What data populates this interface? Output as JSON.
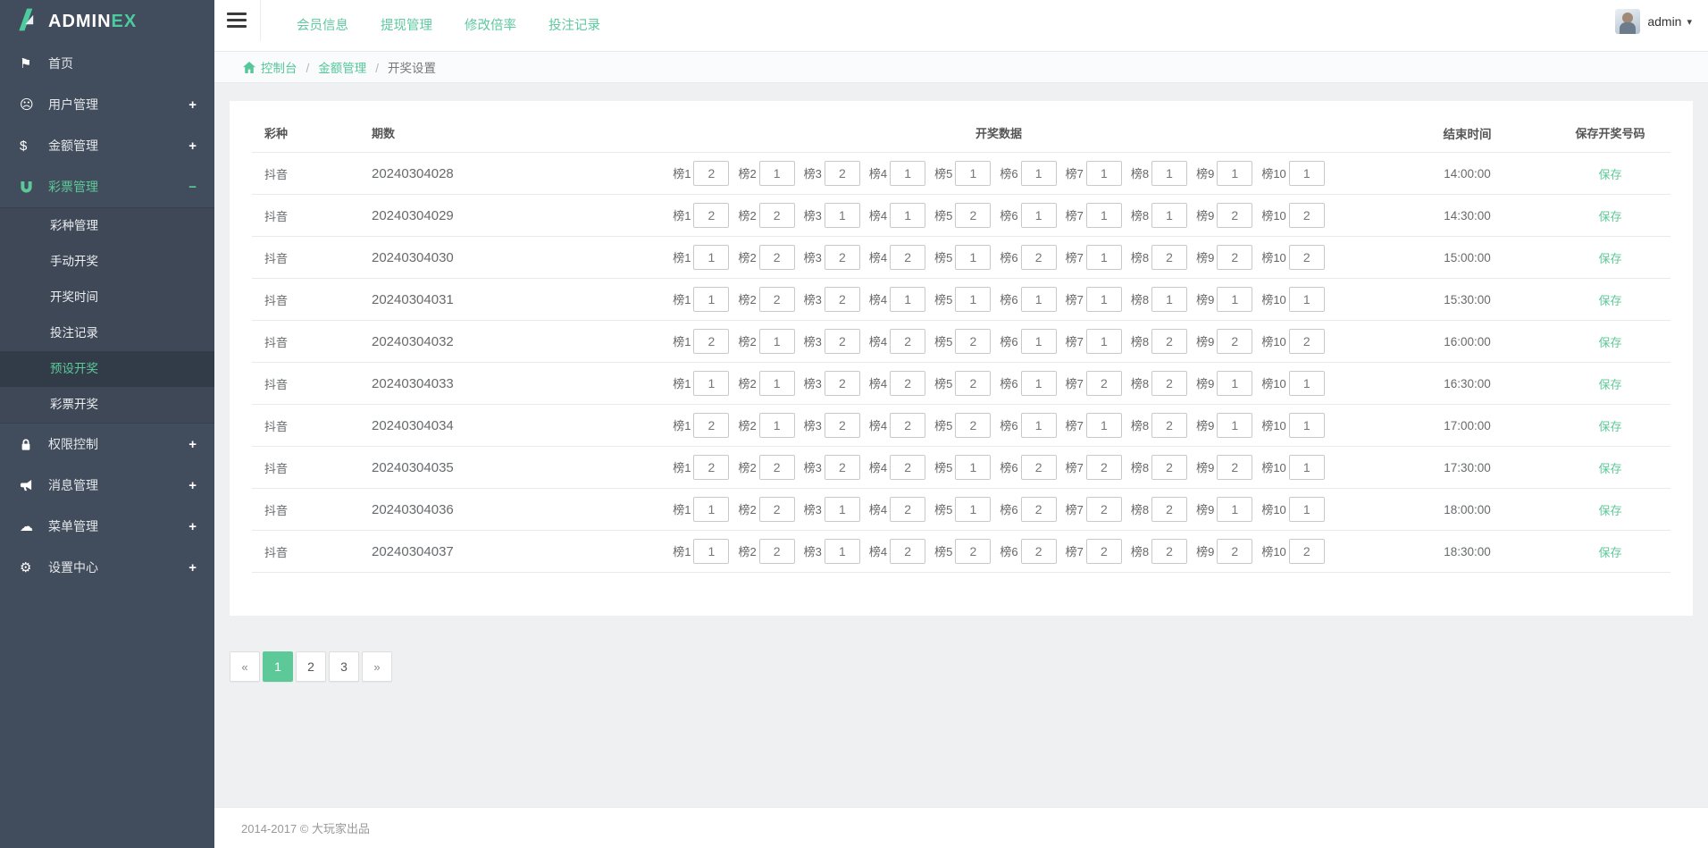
{
  "colors": {
    "accent": "#5dc998",
    "logo_green": "#4ecb9e",
    "sidebar_bg": "#414c5c",
    "sidebar_submenu_bg": "#3e4857",
    "sidebar_active_bg": "#323b48",
    "content_bg": "#eef0f1"
  },
  "brand": {
    "name_main": "ADMIN",
    "name_suffix": "EX"
  },
  "topnav": {
    "links": [
      "会员信息",
      "提现管理",
      "修改倍率",
      "投注记录"
    ]
  },
  "user": {
    "name": "admin"
  },
  "sidebar": {
    "items": [
      {
        "id": "home",
        "label": "首页",
        "icon": "flag-icon",
        "expand": ""
      },
      {
        "id": "users",
        "label": "用户管理",
        "icon": "user-icon",
        "expand": "+"
      },
      {
        "id": "finance",
        "label": "金额管理",
        "icon": "dollar-icon",
        "expand": "+"
      },
      {
        "id": "lottery",
        "label": "彩票管理",
        "icon": "magnet-icon",
        "expand": "−",
        "active": true,
        "children": [
          {
            "id": "lottery-types",
            "label": "彩种管理"
          },
          {
            "id": "manual-draw",
            "label": "手动开奖"
          },
          {
            "id": "draw-time",
            "label": "开奖时间"
          },
          {
            "id": "bet-records",
            "label": "投注记录"
          },
          {
            "id": "preset-draw",
            "label": "预设开奖",
            "active": true
          },
          {
            "id": "lottery-draw",
            "label": "彩票开奖"
          }
        ]
      },
      {
        "id": "permissions",
        "label": "权限控制",
        "icon": "lock-icon",
        "expand": "+"
      },
      {
        "id": "messages",
        "label": "消息管理",
        "icon": "megaphone-icon",
        "expand": "+"
      },
      {
        "id": "menus",
        "label": "菜单管理",
        "icon": "cloud-icon",
        "expand": "+"
      },
      {
        "id": "settings",
        "label": "设置中心",
        "icon": "gear-icon",
        "expand": "+"
      }
    ]
  },
  "breadcrumb": {
    "items": [
      {
        "label": "控制台",
        "link": true
      },
      {
        "label": "金额管理",
        "link": true
      },
      {
        "label": "开奖设置",
        "link": false
      }
    ]
  },
  "table": {
    "headers": {
      "type": "彩种",
      "period": "期数",
      "data": "开奖数据",
      "end_time": "结束时间",
      "save": "保存开奖号码"
    },
    "rank_labels": [
      "榜1",
      "榜2",
      "榜3",
      "榜4",
      "榜5",
      "榜6",
      "榜7",
      "榜8",
      "榜9",
      "榜10"
    ],
    "rows": [
      {
        "type": "抖音",
        "period": "20240304028",
        "values": [
          "2",
          "1",
          "2",
          "1",
          "1",
          "1",
          "1",
          "1",
          "1",
          "1"
        ],
        "end_time": "14:00:00",
        "save_label": "保存"
      },
      {
        "type": "抖音",
        "period": "20240304029",
        "values": [
          "2",
          "2",
          "1",
          "1",
          "2",
          "1",
          "1",
          "1",
          "2",
          "2"
        ],
        "end_time": "14:30:00",
        "save_label": "保存"
      },
      {
        "type": "抖音",
        "period": "20240304030",
        "values": [
          "1",
          "2",
          "2",
          "2",
          "1",
          "2",
          "1",
          "2",
          "2",
          "2"
        ],
        "end_time": "15:00:00",
        "save_label": "保存"
      },
      {
        "type": "抖音",
        "period": "20240304031",
        "values": [
          "1",
          "2",
          "2",
          "1",
          "1",
          "1",
          "1",
          "1",
          "1",
          "1"
        ],
        "end_time": "15:30:00",
        "save_label": "保存"
      },
      {
        "type": "抖音",
        "period": "20240304032",
        "values": [
          "2",
          "1",
          "2",
          "2",
          "2",
          "1",
          "1",
          "2",
          "2",
          "2"
        ],
        "end_time": "16:00:00",
        "save_label": "保存"
      },
      {
        "type": "抖音",
        "period": "20240304033",
        "values": [
          "1",
          "1",
          "2",
          "2",
          "2",
          "1",
          "2",
          "2",
          "1",
          "1"
        ],
        "end_time": "16:30:00",
        "save_label": "保存"
      },
      {
        "type": "抖音",
        "period": "20240304034",
        "values": [
          "2",
          "1",
          "2",
          "2",
          "2",
          "1",
          "1",
          "2",
          "1",
          "1"
        ],
        "end_time": "17:00:00",
        "save_label": "保存"
      },
      {
        "type": "抖音",
        "period": "20240304035",
        "values": [
          "2",
          "2",
          "2",
          "2",
          "1",
          "2",
          "2",
          "2",
          "2",
          "1"
        ],
        "end_time": "17:30:00",
        "save_label": "保存"
      },
      {
        "type": "抖音",
        "period": "20240304036",
        "values": [
          "1",
          "2",
          "1",
          "2",
          "1",
          "2",
          "2",
          "2",
          "1",
          "1"
        ],
        "end_time": "18:00:00",
        "save_label": "保存"
      },
      {
        "type": "抖音",
        "period": "20240304037",
        "values": [
          "1",
          "2",
          "1",
          "2",
          "2",
          "2",
          "2",
          "2",
          "2",
          "2"
        ],
        "end_time": "18:30:00",
        "save_label": "保存"
      }
    ]
  },
  "pagination": {
    "prev": "«",
    "pages": [
      "1",
      "2",
      "3"
    ],
    "active": "1",
    "next": "»"
  },
  "footer": {
    "text": "2014-2017 © 大玩家出品"
  }
}
